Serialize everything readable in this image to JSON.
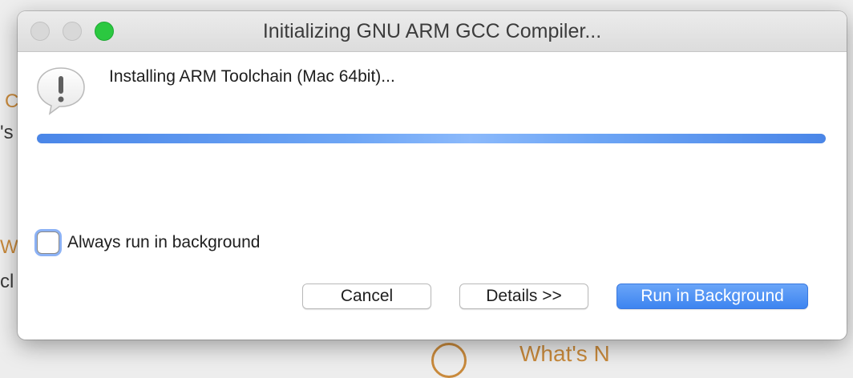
{
  "window": {
    "title": "Initializing GNU ARM GCC Compiler..."
  },
  "dialog": {
    "icon": "alert-caution-icon",
    "message": "Installing ARM Toolchain (Mac 64bit)...",
    "progress": 1.0,
    "checkbox_label": "Always run in background",
    "checkbox_checked": false
  },
  "buttons": {
    "cancel": "Cancel",
    "details": "Details >>",
    "run_background": "Run in Background"
  },
  "background_fragments": {
    "f1": "C",
    "f2": "'s",
    "f3": "W",
    "f4": "cl",
    "f5": "What's N"
  },
  "colors": {
    "accent": "#3d84f0",
    "progress": "#4a86e8",
    "zoom": "#2bc840",
    "background_link": "#c98a3c"
  }
}
